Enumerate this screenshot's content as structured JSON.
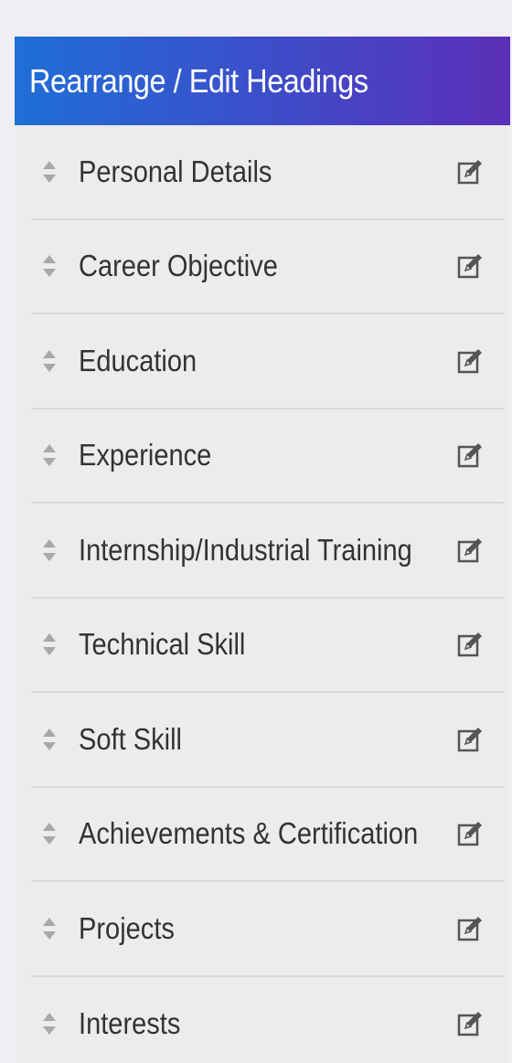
{
  "header": {
    "title": "Rearrange / Edit Headings"
  },
  "colors": {
    "header_start": "#1f6fd6",
    "header_end": "#5c2fb8",
    "panel_bg": "#ececec",
    "text": "#333333",
    "icon": "#555555"
  },
  "icons": {
    "drag": "sort-arrows-icon",
    "edit": "edit-pencil-icon"
  },
  "headings": [
    {
      "label": "Personal Details"
    },
    {
      "label": "Career Objective"
    },
    {
      "label": "Education"
    },
    {
      "label": "Experience"
    },
    {
      "label": "Internship/Industrial Training"
    },
    {
      "label": "Technical Skill"
    },
    {
      "label": "Soft Skill"
    },
    {
      "label": "Achievements & Certification"
    },
    {
      "label": "Projects"
    },
    {
      "label": "Interests"
    }
  ]
}
